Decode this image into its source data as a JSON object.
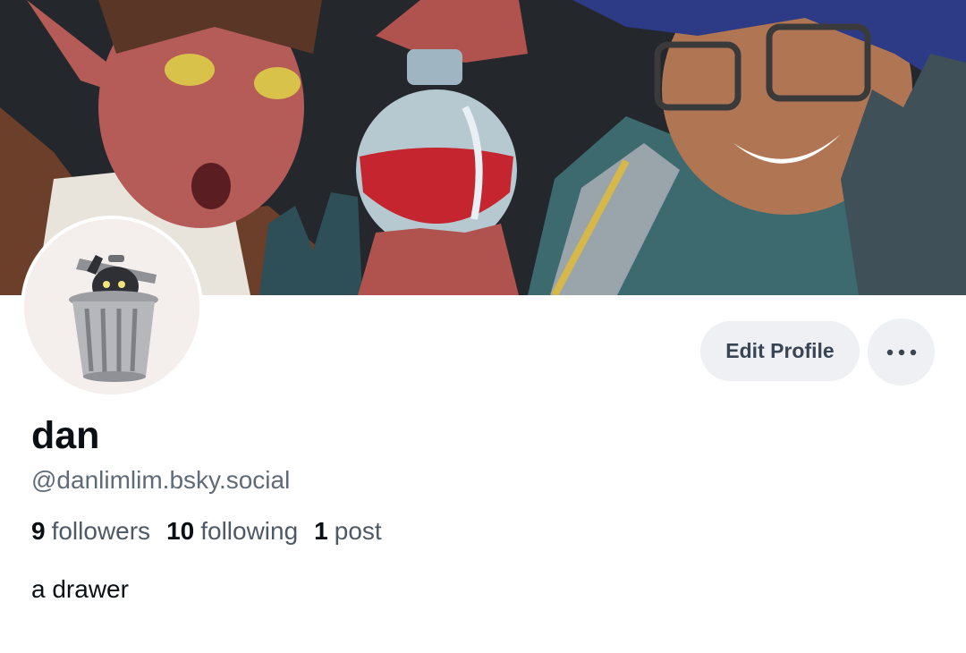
{
  "profile": {
    "display_name": "dan",
    "handle": "@danlimlim.bsky.social",
    "bio": "a drawer"
  },
  "actions": {
    "edit_profile_label": "Edit Profile",
    "more_icon": "ellipsis-horizontal-icon"
  },
  "stats": {
    "followers_count": "9",
    "followers_label": "followers",
    "following_count": "10",
    "following_label": "following",
    "posts_count": "1",
    "posts_label": "post"
  },
  "banner": {
    "description_icon": "banner-artwork-image"
  },
  "avatar": {
    "icon": "trash-can-creature-icon"
  },
  "colors": {
    "button_bg": "#eef0f3",
    "button_text": "#3a4553",
    "secondary_text": "#5f6b78",
    "primary_text": "#0b0f14"
  }
}
